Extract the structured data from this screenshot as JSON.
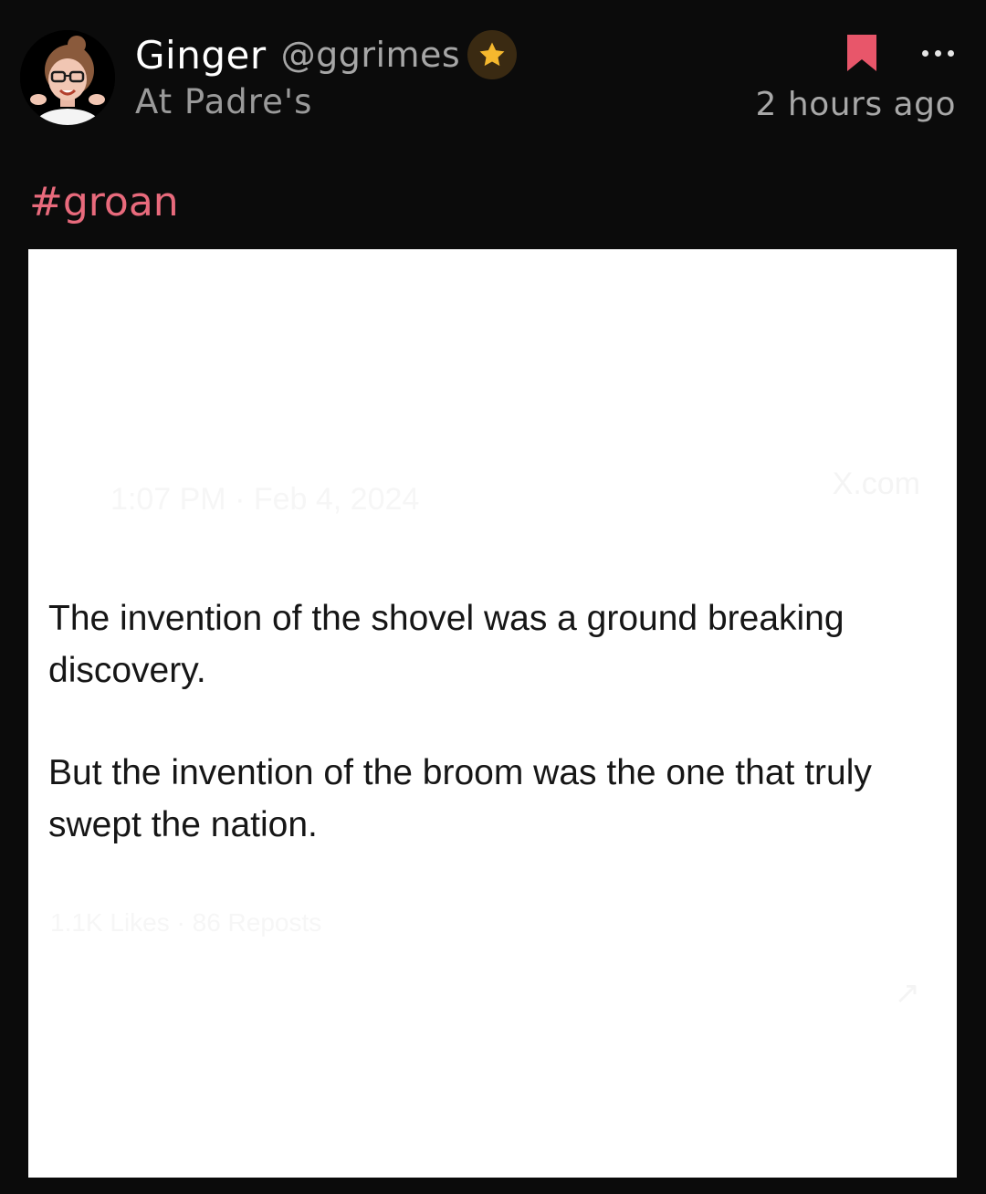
{
  "post": {
    "author": {
      "display_name": "Ginger",
      "handle": "@ggrimes",
      "location": "At Padre's",
      "badge_icon": "star-icon"
    },
    "timestamp": "2 hours ago",
    "hashtag": "#groan",
    "actions": {
      "bookmark_icon": "bookmark-icon",
      "more_icon": "more-options-icon"
    },
    "image": {
      "ghost_texts": [
        "1:07 PM · Feb 4, 2024",
        "X.com",
        "1.1K Likes · 86 Reposts",
        "↗"
      ],
      "paragraphs": [
        "The invention of the shovel was a ground breaking discovery.",
        "But the invention of the broom was the one that truly swept the nation."
      ]
    }
  },
  "colors": {
    "background": "#0b0b0b",
    "hashtag": "#e86a7c",
    "bookmark": "#e8566a",
    "star": "#f5b82e",
    "muted_text": "#9a9a9a"
  }
}
